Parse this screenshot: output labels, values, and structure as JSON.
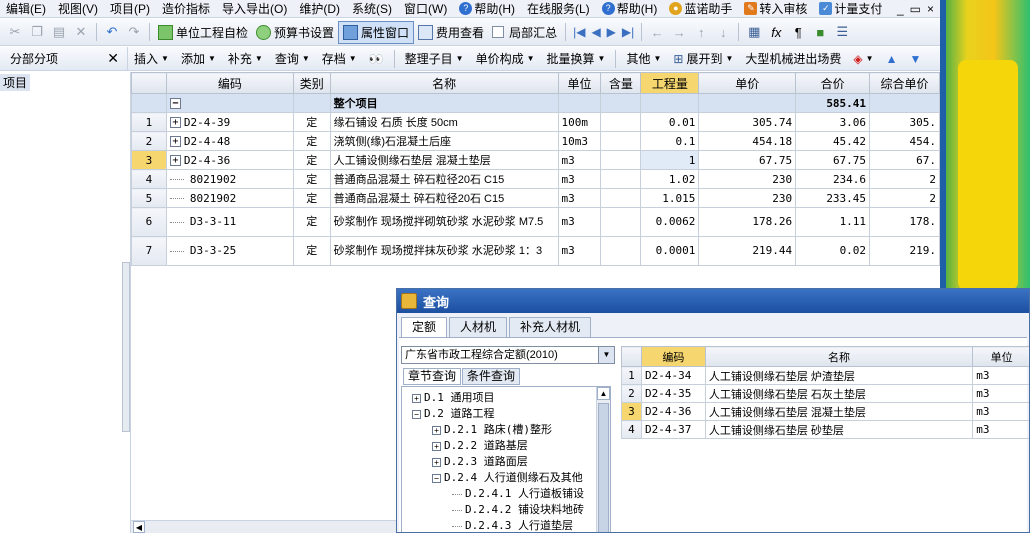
{
  "menu": [
    {
      "label": "编辑(E)"
    },
    {
      "label": "视图(V)"
    },
    {
      "label": "项目(P)"
    },
    {
      "label": "造价指标"
    },
    {
      "label": "导入导出(O)"
    },
    {
      "label": "维护(D)"
    },
    {
      "label": "系统(S)"
    },
    {
      "label": "窗口(W)"
    },
    {
      "label": "帮助(H)",
      "icon": "help-icon"
    },
    {
      "label": "在线服务(L)"
    },
    {
      "label": "帮助(H)"
    },
    {
      "label": "蓝诺助手"
    },
    {
      "label": "转入审核"
    },
    {
      "label": "计量支付"
    }
  ],
  "window_controls": {
    "minimize": "_",
    "restore": "▭",
    "close": "×"
  },
  "toolbar1": {
    "self_check": "单位工程自检",
    "budget_settings": "预算书设置",
    "property_window": "属性窗口",
    "fee_view": "费用查看",
    "partial_summary": "局部汇总"
  },
  "toolbar2": {
    "panel_title": "分部分项",
    "insert": "插入",
    "add": "添加",
    "supplement": "补充",
    "query": "查询",
    "save": "存档",
    "organize_subitems": "整理子目",
    "unit_price_composition": "单价构成",
    "batch_conversion": "批量换算",
    "other": "其他",
    "expand_to": "展开到",
    "machinery_fee": "大型机械进出场费"
  },
  "left_tree": {
    "root": "项目"
  },
  "grid": {
    "columns": [
      "",
      "编码",
      "类别",
      "名称",
      "单位",
      "含量",
      "工程量",
      "单价",
      "合价",
      "综合单价"
    ],
    "group_row": {
      "name": "整个项目",
      "total": "585.41"
    },
    "rows": [
      {
        "no": "1",
        "code": "D2-4-39",
        "type": "定",
        "name": "缘石铺设 石质 长度 50cm",
        "unit": "100m",
        "content": "",
        "qty": "0.01",
        "price": "305.74",
        "total": "3.06",
        "comp": "305."
      },
      {
        "no": "2",
        "code": "D2-4-48",
        "type": "定",
        "name": "浇筑侧(缘)石混凝土后座",
        "unit": "10m3",
        "content": "",
        "qty": "0.1",
        "price": "454.18",
        "total": "45.42",
        "comp": "454."
      },
      {
        "no": "3",
        "code": "D2-4-36",
        "type": "定",
        "name": "人工铺设侧缘石垫层 混凝土垫层",
        "unit": "m3",
        "content": "",
        "qty": "1",
        "price": "67.75",
        "total": "67.75",
        "comp": "67."
      },
      {
        "no": "4",
        "code": "8021902",
        "type": "定",
        "name": "普通商品混凝土 碎石粒径20石 C15",
        "unit": "m3",
        "content": "",
        "qty": "1.02",
        "price": "230",
        "total": "234.6",
        "comp": "2"
      },
      {
        "no": "5",
        "code": "8021902",
        "type": "定",
        "name": "普通商品混凝土 碎石粒径20石 C15",
        "unit": "m3",
        "content": "",
        "qty": "1.015",
        "price": "230",
        "total": "233.45",
        "comp": "2"
      },
      {
        "no": "6",
        "code": "D3-3-11",
        "type": "定",
        "name": "砂浆制作 现场搅拌砌筑砂浆 水泥砂浆 M7.5",
        "unit": "m3",
        "content": "",
        "qty": "0.0062",
        "price": "178.26",
        "total": "1.11",
        "comp": "178."
      },
      {
        "no": "7",
        "code": "D3-3-25",
        "type": "定",
        "name": "砂浆制作 现场搅拌抹灰砂浆 水泥砂浆 1：3",
        "unit": "m3",
        "content": "",
        "qty": "0.0001",
        "price": "219.44",
        "total": "0.02",
        "comp": "219."
      }
    ]
  },
  "dialog": {
    "title": "查询",
    "tabs": [
      "定额",
      "人材机",
      "补充人材机"
    ],
    "quota_library": "广东省市政工程综合定额(2010)",
    "subtabs": [
      "章节查询",
      "条件查询"
    ],
    "tree": [
      {
        "label": "D.1 通用项目",
        "sign": "+"
      },
      {
        "label": "D.2 道路工程",
        "sign": "−"
      },
      {
        "label": "D.2.1 路床(槽)整形",
        "sign": "+"
      },
      {
        "label": "D.2.2 道路基层",
        "sign": "+"
      },
      {
        "label": "D.2.3 道路面层",
        "sign": "+"
      },
      {
        "label": "D.2.4 人行道侧缘石及其他",
        "sign": "−"
      },
      {
        "label": "D.2.4.1 人行道板铺设"
      },
      {
        "label": "D.2.4.2 铺设块料地砖"
      },
      {
        "label": "D.2.4.3 人行道垫层"
      }
    ],
    "columns": [
      "",
      "编码",
      "名称",
      "单位"
    ],
    "rows": [
      {
        "no": "1",
        "code": "D2-4-34",
        "name": "人工铺设侧缘石垫层 炉渣垫层",
        "unit": "m3"
      },
      {
        "no": "2",
        "code": "D2-4-35",
        "name": "人工铺设侧缘石垫层 石灰土垫层",
        "unit": "m3"
      },
      {
        "no": "3",
        "code": "D2-4-36",
        "name": "人工铺设侧缘石垫层 混凝土垫层",
        "unit": "m3"
      },
      {
        "no": "4",
        "code": "D2-4-37",
        "name": "人工铺设侧缘石垫层 砂垫层",
        "unit": "m3"
      }
    ]
  },
  "colors": {
    "accent": "#1c4fa0",
    "highlight": "#f6d66e",
    "group_row": "#d6e2f1"
  }
}
